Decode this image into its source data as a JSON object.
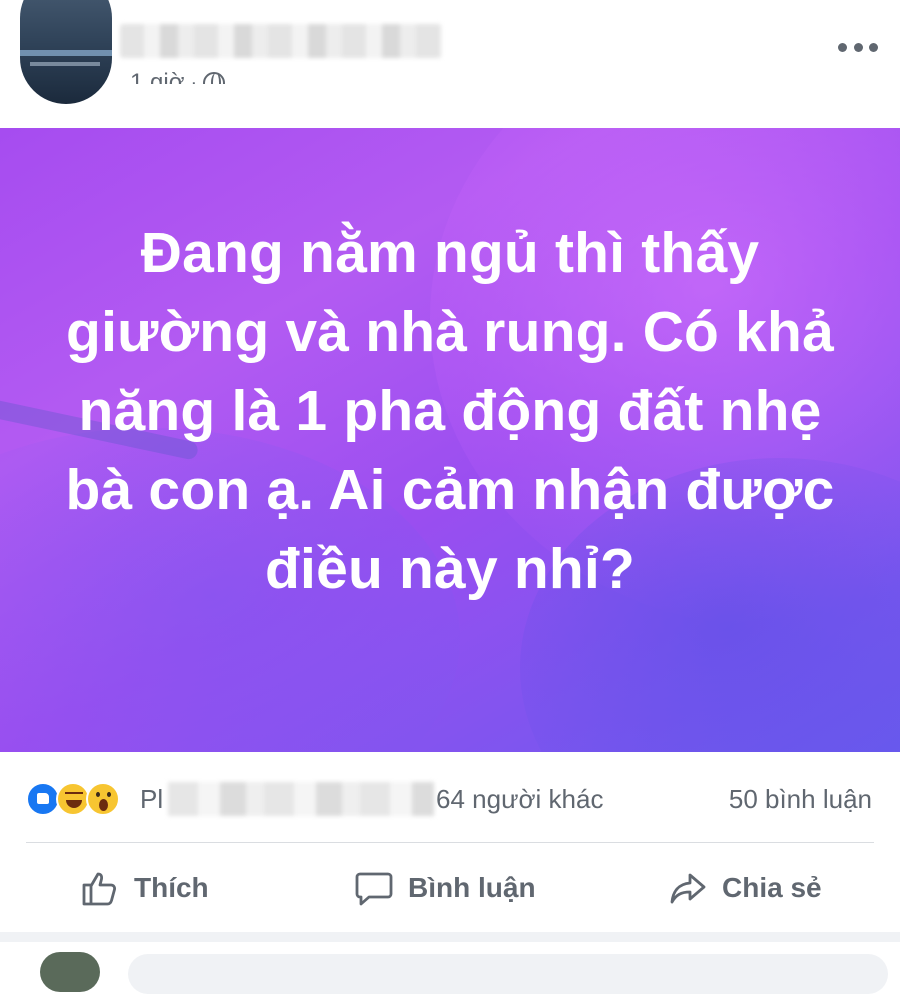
{
  "post": {
    "author_name": "",
    "time": "1 giờ",
    "separator": "·",
    "privacy_icon": "globe-icon",
    "more_icon": "more-icon",
    "status_text": "Đang nằm ngủ thì thấy giường và nhà rung. Có khả năng là 1 pha động đất nhẹ bà con ạ. Ai cảm nhận được điều này nhỉ?",
    "background_colors": [
      "#a64cf0",
      "#7f55ef"
    ]
  },
  "summary": {
    "reaction_icons": [
      "like-icon",
      "haha-icon",
      "wow-icon"
    ],
    "likers_prefix": "Pl",
    "others_text": "64 người khác",
    "comments_text": "50 bình luận"
  },
  "actions": {
    "like_label": "Thích",
    "comment_label": "Bình luận",
    "share_label": "Chia sẻ"
  },
  "colors": {
    "accent": "#1877f2",
    "secondary_text": "#606770"
  }
}
